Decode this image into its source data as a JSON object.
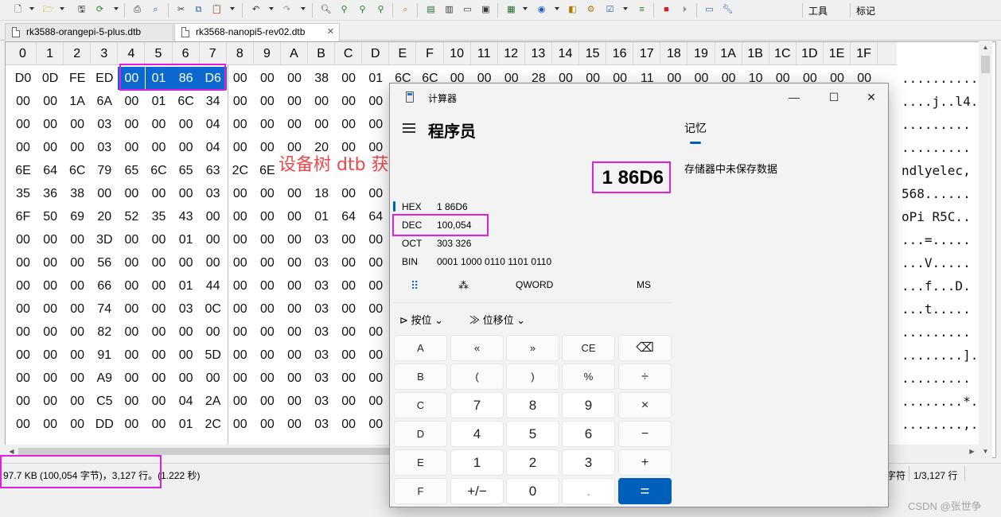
{
  "toolbar": {
    "menu_tools": "工具",
    "menu_bookmarks": "标记"
  },
  "tabs": [
    {
      "label": "rk3588-orangepi-5-plus.dtb",
      "active": false
    },
    {
      "label": "rk3568-nanopi5-rev02.dtb",
      "active": true,
      "close": "✕"
    }
  ],
  "hex_editor": {
    "columns": [
      "0",
      "1",
      "2",
      "3",
      "4",
      "5",
      "6",
      "7",
      "8",
      "9",
      "A",
      "B",
      "C",
      "D",
      "E",
      "F",
      "10",
      "11",
      "12",
      "13",
      "14",
      "15",
      "16",
      "17",
      "18",
      "19",
      "1A",
      "1B",
      "1C",
      "1D",
      "1E",
      "1F"
    ],
    "rows": [
      {
        "bytes": [
          "D0",
          "0D",
          "FE",
          "ED",
          "00",
          "01",
          "86",
          "D6",
          "00",
          "00",
          "00",
          "38",
          "00",
          "01",
          "6C",
          "6C",
          "00",
          "00",
          "00",
          "28",
          "00",
          "00",
          "00",
          "11",
          "00",
          "00",
          "00",
          "10",
          "00",
          "00",
          "00",
          "00"
        ],
        "ascii": "............."
      },
      {
        "bytes": [
          "00",
          "00",
          "1A",
          "6A",
          "00",
          "01",
          "6C",
          "34",
          "00",
          "00",
          "00",
          "00",
          "00",
          "00",
          "",
          "",
          "",
          "",
          "",
          "",
          "",
          "",
          "",
          "",
          "",
          "",
          "",
          "",
          "",
          "",
          "",
          ""
        ],
        "ascii": "....j..l4."
      },
      {
        "bytes": [
          "00",
          "00",
          "00",
          "03",
          "00",
          "00",
          "00",
          "04",
          "00",
          "00",
          "00",
          "00",
          "00",
          "00",
          "",
          "",
          "",
          "",
          "",
          "",
          "",
          "",
          "",
          "",
          "",
          "",
          "",
          "",
          "",
          "",
          "",
          ""
        ],
        "ascii": "........."
      },
      {
        "bytes": [
          "00",
          "00",
          "00",
          "03",
          "00",
          "00",
          "00",
          "04",
          "00",
          "00",
          "00",
          "20",
          "00",
          "00",
          "",
          "",
          "",
          "",
          "",
          "",
          "",
          "",
          "",
          "",
          "",
          "",
          "",
          "",
          "",
          "",
          "",
          ""
        ],
        "ascii": "........."
      },
      {
        "bytes": [
          "6E",
          "64",
          "6C",
          "79",
          "65",
          "6C",
          "65",
          "63",
          "2C",
          "6E",
          "",
          "",
          "",
          "",
          "",
          "",
          "",
          "",
          "",
          "",
          "",
          "",
          "",
          "",
          "",
          "",
          "",
          "",
          "",
          "",
          "",
          ""
        ],
        "ascii": "ndlyelec,"
      },
      {
        "bytes": [
          "35",
          "36",
          "38",
          "00",
          "00",
          "00",
          "00",
          "03",
          "00",
          "00",
          "00",
          "18",
          "00",
          "00",
          "",
          "",
          "",
          "",
          "",
          "",
          "",
          "",
          "",
          "",
          "",
          "",
          "",
          "",
          "",
          "",
          "",
          ""
        ],
        "ascii": "568......"
      },
      {
        "bytes": [
          "6F",
          "50",
          "69",
          "20",
          "52",
          "35",
          "43",
          "00",
          "00",
          "00",
          "00",
          "01",
          "64",
          "64",
          "",
          "",
          "",
          "",
          "",
          "",
          "",
          "",
          "",
          "",
          "",
          "",
          "",
          "",
          "",
          "",
          "",
          ""
        ],
        "ascii": "oPi R5C.."
      },
      {
        "bytes": [
          "00",
          "00",
          "00",
          "3D",
          "00",
          "00",
          "01",
          "00",
          "00",
          "00",
          "00",
          "03",
          "00",
          "00",
          "",
          "",
          "",
          "",
          "",
          "",
          "",
          "",
          "",
          "",
          "",
          "",
          "",
          "",
          "",
          "",
          "",
          ""
        ],
        "ascii": "...=....."
      },
      {
        "bytes": [
          "00",
          "00",
          "00",
          "56",
          "00",
          "00",
          "00",
          "00",
          "00",
          "00",
          "00",
          "03",
          "00",
          "00",
          "",
          "",
          "",
          "",
          "",
          "",
          "",
          "",
          "",
          "",
          "",
          "",
          "",
          "",
          "",
          "",
          "",
          ""
        ],
        "ascii": "...V....."
      },
      {
        "bytes": [
          "00",
          "00",
          "00",
          "66",
          "00",
          "00",
          "01",
          "44",
          "00",
          "00",
          "00",
          "03",
          "00",
          "00",
          "",
          "",
          "",
          "",
          "",
          "",
          "",
          "",
          "",
          "",
          "",
          "",
          "",
          "",
          "",
          "",
          "",
          ""
        ],
        "ascii": "...f...D."
      },
      {
        "bytes": [
          "00",
          "00",
          "00",
          "74",
          "00",
          "00",
          "03",
          "0C",
          "00",
          "00",
          "00",
          "03",
          "00",
          "00",
          "",
          "",
          "",
          "",
          "",
          "",
          "",
          "",
          "",
          "",
          "",
          "",
          "",
          "",
          "",
          "",
          "",
          ""
        ],
        "ascii": "...t....."
      },
      {
        "bytes": [
          "00",
          "00",
          "00",
          "82",
          "00",
          "00",
          "00",
          "00",
          "00",
          "00",
          "00",
          "03",
          "00",
          "00",
          "",
          "",
          "",
          "",
          "",
          "",
          "",
          "",
          "",
          "",
          "",
          "",
          "",
          "",
          "",
          "",
          "",
          ""
        ],
        "ascii": "........."
      },
      {
        "bytes": [
          "00",
          "00",
          "00",
          "91",
          "00",
          "00",
          "00",
          "5D",
          "00",
          "00",
          "00",
          "03",
          "00",
          "00",
          "",
          "",
          "",
          "",
          "",
          "",
          "",
          "",
          "",
          "",
          "",
          "",
          "",
          "",
          "",
          "",
          "",
          ""
        ],
        "ascii": "........]."
      },
      {
        "bytes": [
          "00",
          "00",
          "00",
          "A9",
          "00",
          "00",
          "00",
          "00",
          "00",
          "00",
          "00",
          "03",
          "00",
          "00",
          "",
          "",
          "",
          "",
          "",
          "",
          "",
          "",
          "",
          "",
          "",
          "",
          "",
          "",
          "",
          "",
          "",
          ""
        ],
        "ascii": "........."
      },
      {
        "bytes": [
          "00",
          "00",
          "00",
          "C5",
          "00",
          "00",
          "04",
          "2A",
          "00",
          "00",
          "00",
          "03",
          "00",
          "00",
          "",
          "",
          "",
          "",
          "",
          "",
          "",
          "",
          "",
          "",
          "",
          "",
          "",
          "",
          "",
          "",
          "",
          ""
        ],
        "ascii": "........*."
      },
      {
        "bytes": [
          "00",
          "00",
          "00",
          "DD",
          "00",
          "00",
          "01",
          "2C",
          "00",
          "00",
          "00",
          "03",
          "00",
          "00",
          "",
          "",
          "",
          "",
          "",
          "",
          "",
          "",
          "",
          "",
          "",
          "",
          "",
          "",
          "",
          "",
          "",
          ""
        ],
        "ascii": "........,."
      }
    ],
    "selected_offsets": [
      4,
      5,
      6,
      7
    ]
  },
  "status": {
    "size": "97.7 KB (100,054 字节)，3,127 行。(1.222 秒)",
    "chars": "字符",
    "lines": "1/3,127 行"
  },
  "annotation": "设备树 dtb 获取 dtb 文件总大小",
  "calculator": {
    "title": "计算器",
    "mode": "程序员",
    "display": "1 86D6",
    "memory_tab": "记忆",
    "memory_empty": "存储器中未保存数据",
    "bases": [
      {
        "label": "HEX",
        "value": "1 86D6"
      },
      {
        "label": "DEC",
        "value": "100,054"
      },
      {
        "label": "OCT",
        "value": "303 326"
      },
      {
        "label": "BIN",
        "value": "0001 1000 0110 1101 0110"
      }
    ],
    "word_size": "QWORD",
    "ms": "MS",
    "bitwise": "按位",
    "bitshift": "位移位",
    "keys": [
      [
        "A",
        "«",
        "»",
        "CE",
        "⌫"
      ],
      [
        "B",
        "(",
        ")",
        "%",
        "÷"
      ],
      [
        "C",
        "7",
        "8",
        "9",
        "×"
      ],
      [
        "D",
        "4",
        "5",
        "6",
        "−"
      ],
      [
        "E",
        "1",
        "2",
        "3",
        "+"
      ],
      [
        "F",
        "+/−",
        "0",
        ".",
        "="
      ]
    ]
  },
  "watermark": "CSDN @张世争"
}
